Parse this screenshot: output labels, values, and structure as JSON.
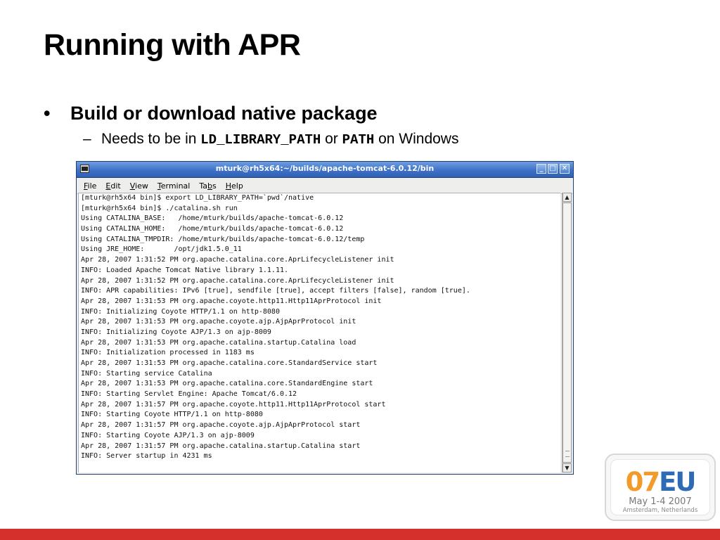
{
  "slide": {
    "title": "Running with APR",
    "bullet": "Build or download native package",
    "sub_prefix": "Needs to be in ",
    "sub_code1": "LD_LIBRARY_PATH",
    "sub_mid": " or ",
    "sub_code2": "PATH",
    "sub_suffix": " on Windows",
    "bullet_glyph": "•",
    "dash_glyph": "–"
  },
  "terminal": {
    "title": "mturk@rh5x64:~/builds/apache-tomcat-6.0.12/bin",
    "menu": [
      {
        "mnemonic": "F",
        "rest": "ile"
      },
      {
        "mnemonic": "E",
        "rest": "dit"
      },
      {
        "mnemonic": "V",
        "rest": "iew"
      },
      {
        "mnemonic": "T",
        "rest": "erminal"
      },
      {
        "mnemonic": "Ta",
        "rest": "bs",
        "mnemonic_is_b": true
      },
      {
        "mnemonic": "H",
        "rest": "elp"
      }
    ],
    "menu_labels": [
      "File",
      "Edit",
      "View",
      "Terminal",
      "Tabs",
      "Help"
    ],
    "lines": [
      "[mturk@rh5x64 bin]$ export LD_LIBRARY_PATH=`pwd`/native",
      "[mturk@rh5x64 bin]$ ./catalina.sh run",
      "Using CATALINA_BASE:   /home/mturk/builds/apache-tomcat-6.0.12",
      "Using CATALINA_HOME:   /home/mturk/builds/apache-tomcat-6.0.12",
      "Using CATALINA_TMPDIR: /home/mturk/builds/apache-tomcat-6.0.12/temp",
      "Using JRE_HOME:       /opt/jdk1.5.0_11",
      "Apr 28, 2007 1:31:52 PM org.apache.catalina.core.AprLifecycleListener init",
      "INFO: Loaded Apache Tomcat Native library 1.1.11.",
      "Apr 28, 2007 1:31:52 PM org.apache.catalina.core.AprLifecycleListener init",
      "INFO: APR capabilities: IPv6 [true], sendfile [true], accept filters [false], random [true].",
      "Apr 28, 2007 1:31:53 PM org.apache.coyote.http11.Http11AprProtocol init",
      "INFO: Initializing Coyote HTTP/1.1 on http-8080",
      "Apr 28, 2007 1:31:53 PM org.apache.coyote.ajp.AjpAprProtocol init",
      "INFO: Initializing Coyote AJP/1.3 on ajp-8009",
      "Apr 28, 2007 1:31:53 PM org.apache.catalina.startup.Catalina load",
      "INFO: Initialization processed in 1183 ms",
      "Apr 28, 2007 1:31:53 PM org.apache.catalina.core.StandardService start",
      "INFO: Starting service Catalina",
      "Apr 28, 2007 1:31:53 PM org.apache.catalina.core.StandardEngine start",
      "INFO: Starting Servlet Engine: Apache Tomcat/6.0.12",
      "Apr 28, 2007 1:31:57 PM org.apache.coyote.http11.Http11AprProtocol start",
      "INFO: Starting Coyote HTTP/1.1 on http-8080",
      "Apr 28, 2007 1:31:57 PM org.apache.coyote.ajp.AjpAprProtocol start",
      "INFO: Starting Coyote AJP/1.3 on ajp-8009",
      "Apr 28, 2007 1:31:57 PM org.apache.catalina.startup.Catalina start",
      "INFO: Server startup in 4231 ms"
    ],
    "window_buttons": {
      "minimize": "_",
      "maximize": "□",
      "close": "✕"
    },
    "scroll_arrows": {
      "up": "▲",
      "down": "▼"
    }
  },
  "logo": {
    "year": "07",
    "region": "EU",
    "dates": "May 1-4 2007",
    "place": "Amsterdam, Netherlands"
  },
  "colors": {
    "footer_bar": "#d5302c",
    "titlebar": "#3e72c8",
    "logo_orange": "#f29a2a",
    "logo_blue": "#2f6ab5"
  }
}
